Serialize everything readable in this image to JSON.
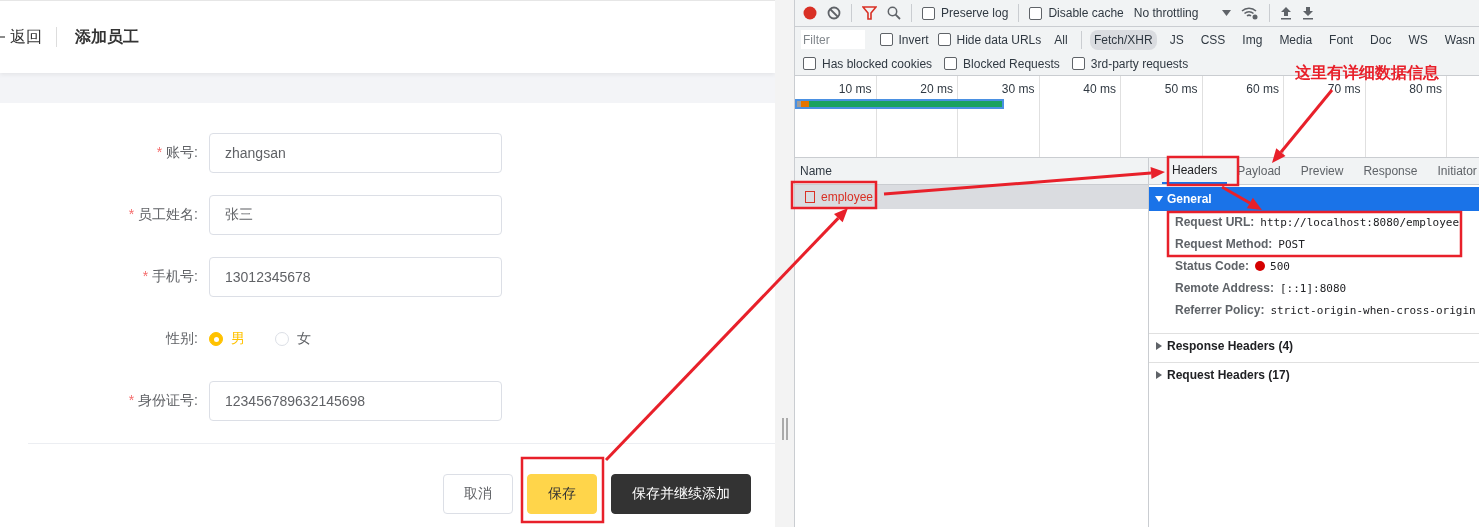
{
  "form_page": {
    "back_link": "返回",
    "title": "添加员工",
    "fields": [
      {
        "kind": "input",
        "required_mark": "*",
        "label": "账号:",
        "value": "zhangsan"
      },
      {
        "kind": "input",
        "required_mark": "*",
        "label": "员工姓名:",
        "value": "张三"
      },
      {
        "kind": "input",
        "required_mark": "*",
        "label": "手机号:",
        "value": "13012345678"
      },
      {
        "kind": "radio",
        "label": "性别:",
        "options": [
          {
            "label": "男",
            "selected": true
          },
          {
            "label": "女",
            "selected": false
          }
        ]
      },
      {
        "kind": "input",
        "required_mark": "*",
        "label": "身份证号:",
        "value": "123456789632145698"
      }
    ],
    "buttons": [
      {
        "kind": "plain",
        "label": "取消"
      },
      {
        "kind": "primary",
        "label": "保存"
      },
      {
        "kind": "dark",
        "label": "保存并继续添加"
      }
    ]
  },
  "devtools": {
    "toolbar": {
      "checkboxes": [
        {
          "label": "Preserve log",
          "checked": false
        },
        {
          "label": "Disable cache",
          "checked": false
        }
      ],
      "throttling": "No throttling"
    },
    "filter": {
      "placeholder": "Filter",
      "checkboxes": [
        {
          "label": "Invert",
          "checked": false
        },
        {
          "label": "Hide data URLs",
          "checked": false
        }
      ],
      "types": [
        {
          "label": "All",
          "selected": false
        },
        {
          "label": "Fetch/XHR",
          "selected": true
        },
        {
          "label": "JS",
          "selected": false
        },
        {
          "label": "CSS",
          "selected": false
        },
        {
          "label": "Img",
          "selected": false
        },
        {
          "label": "Media",
          "selected": false
        },
        {
          "label": "Font",
          "selected": false
        },
        {
          "label": "Doc",
          "selected": false
        },
        {
          "label": "WS",
          "selected": false
        },
        {
          "label": "Wasn",
          "selected": false
        }
      ]
    },
    "request_filters": [
      {
        "label": "Has blocked cookies",
        "checked": false
      },
      {
        "label": "Blocked Requests",
        "checked": false
      },
      {
        "label": "3rd-party requests",
        "checked": false
      }
    ],
    "timeline_ticks": [
      "10 ms",
      "20 ms",
      "30 ms",
      "40 ms",
      "50 ms",
      "60 ms",
      "70 ms",
      "80 ms"
    ],
    "name_column": "Name",
    "requests": [
      {
        "name": "employee",
        "selected": true
      }
    ],
    "tabs": [
      {
        "label": "Headers",
        "selected": true
      },
      {
        "label": "Payload",
        "selected": false
      },
      {
        "label": "Preview",
        "selected": false
      },
      {
        "label": "Response",
        "selected": false
      },
      {
        "label": "Initiator",
        "selected": false
      }
    ],
    "sections": [
      {
        "title": "General",
        "expanded": true,
        "rows": [
          {
            "kind": "text",
            "key": "Request URL:",
            "value": "http://localhost:8080/employee"
          },
          {
            "kind": "text",
            "key": "Request Method:",
            "value": "POST"
          },
          {
            "kind": "status",
            "key": "Status Code:",
            "value": "500"
          },
          {
            "kind": "text",
            "key": "Remote Address:",
            "value": "[::1]:8080"
          },
          {
            "kind": "text",
            "key": "Referrer Policy:",
            "value": "strict-origin-when-cross-origin"
          }
        ]
      },
      {
        "title": "Response Headers (4)",
        "expanded": false
      },
      {
        "title": "Request Headers (17)",
        "expanded": false
      }
    ]
  },
  "annotation": "这里有详细数据信息"
}
